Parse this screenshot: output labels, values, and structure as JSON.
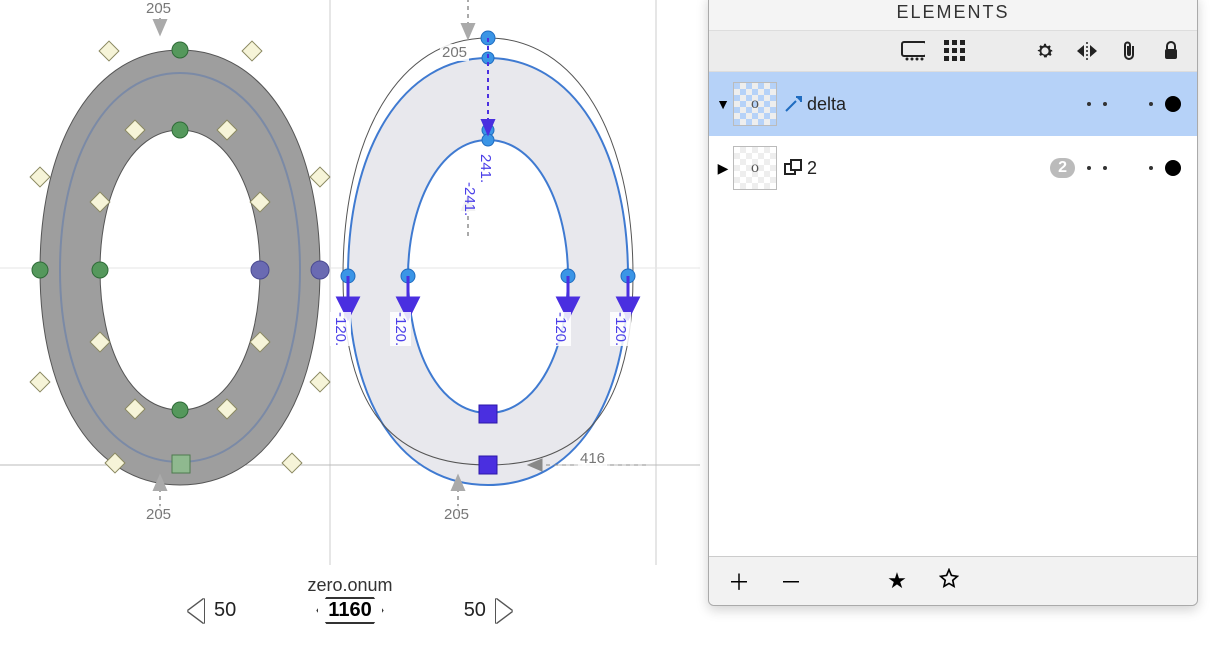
{
  "glyph_name": "zero.onum",
  "left_sidebearing": "50",
  "right_sidebearing": "50",
  "advance_width": "1160",
  "baseline_measurement": "416",
  "delta_arrows": {
    "top_outer": "205",
    "bottom_outer": "205",
    "top_right_outer": "205",
    "bottom_right_outer": "205",
    "inner_top": "241.",
    "inner_top2": "-241.",
    "extremes": [
      "-120.",
      "-120.",
      "-120.",
      "-120."
    ]
  },
  "elements_panel": {
    "title": "ELEMENTS",
    "layers": [
      {
        "name": "delta",
        "thumb": "o",
        "expanded": true,
        "link": true,
        "count": null
      },
      {
        "name": "2",
        "thumb": "o",
        "expanded": false,
        "link": false,
        "count": "2"
      }
    ]
  }
}
